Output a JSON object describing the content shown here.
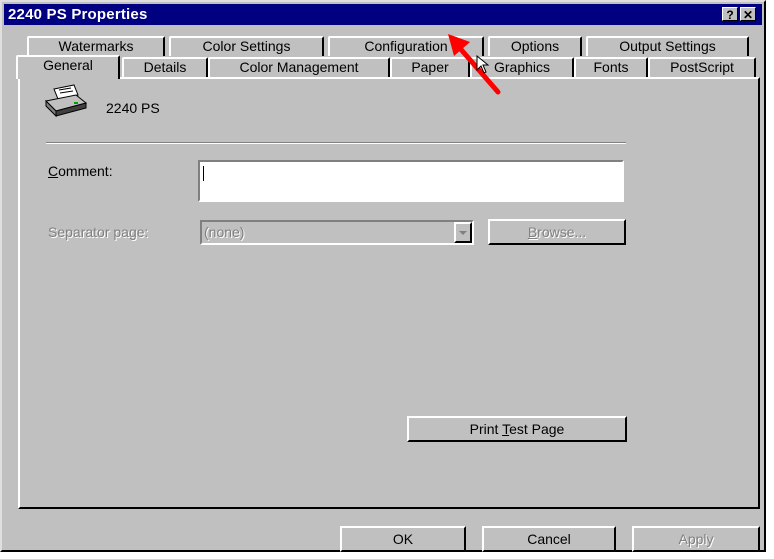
{
  "window": {
    "title": "2240 PS Properties",
    "help_btn": "?",
    "close_btn": "✕"
  },
  "tabs": {
    "row_top": [
      "Watermarks",
      "Color Settings",
      "Configuration",
      "Options",
      "Output Settings"
    ],
    "row_bottom": [
      "General",
      "Details",
      "Color Management",
      "Paper",
      "Graphics",
      "Fonts",
      "PostScript"
    ],
    "active": "General"
  },
  "general": {
    "printer_name": "2240 PS",
    "comment_label": "Comment:",
    "comment_value": "",
    "separator_label": "Separator page:",
    "separator_value": "(none)",
    "browse_label": "Browse...",
    "print_test_label": "Print Test Page"
  },
  "footer": {
    "ok": "OK",
    "cancel": "Cancel",
    "apply": "Apply"
  },
  "colors": {
    "titlebar": "#000080",
    "face": "#c0c0c0",
    "arrow": "#ff0000"
  }
}
